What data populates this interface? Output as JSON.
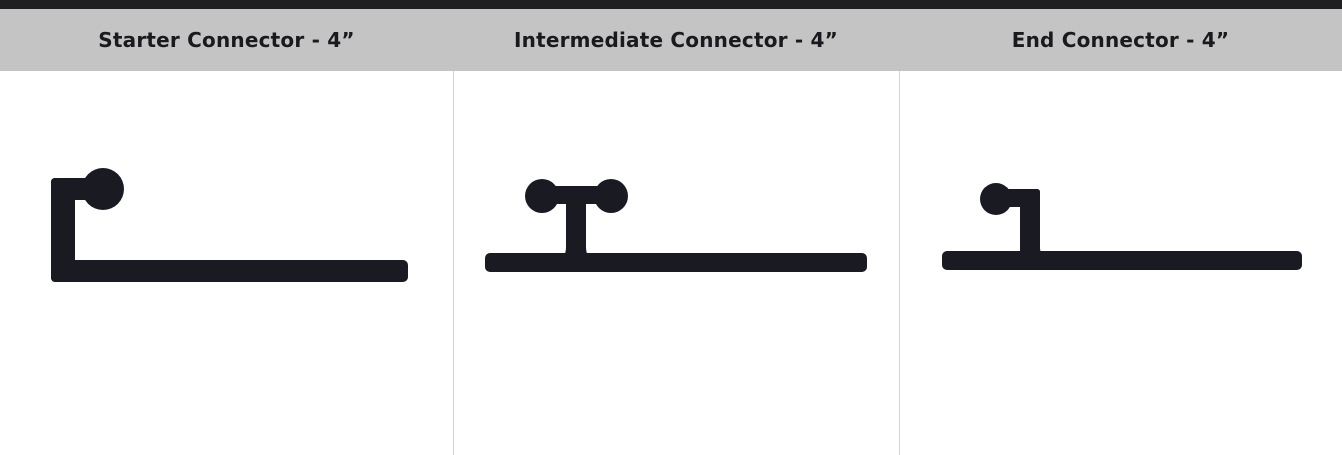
{
  "columns": [
    {
      "title": "Starter Connector - 4”",
      "profile_icon": "starter-connector-profile"
    },
    {
      "title": "Intermediate Connector - 4”",
      "profile_icon": "intermediate-connector-profile"
    },
    {
      "title": "End Connector - 4”",
      "profile_icon": "end-connector-profile"
    }
  ],
  "colors": {
    "top_bar": "#1f1f21",
    "header_background": "#c4c4c4",
    "header_text": "#1a1a1e",
    "profile_fill": "#1a1a22",
    "divider": "#d4d4d4"
  }
}
